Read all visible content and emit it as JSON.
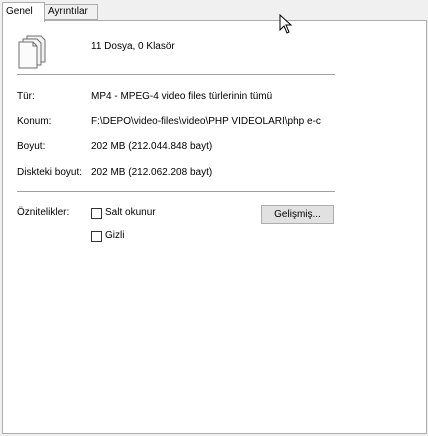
{
  "tabs": [
    {
      "label": "Genel"
    },
    {
      "label": "Ayrıntılar"
    }
  ],
  "summary": {
    "text": "11 Dosya, 0 Klasör",
    "icon": "documents-icon"
  },
  "fields": {
    "type": {
      "label": "Tür:",
      "value": "MP4 - MPEG-4 video files türlerinin tümü"
    },
    "location": {
      "label": "Konum:",
      "value": "F:\\DEPO\\video-files\\video\\PHP VİDEOLARI\\php e-c"
    },
    "size": {
      "label": "Boyut:",
      "value": "202 MB (212.044.848 bayt)"
    },
    "disk_size": {
      "label": "Diskteki boyut:",
      "value": "202 MB (212.062.208 bayt)"
    }
  },
  "attributes": {
    "label": "Öznitelikler:",
    "readonly": {
      "label": "Salt okunur",
      "checked": false
    },
    "hidden": {
      "label": "Gizli",
      "checked": false
    },
    "advanced_button": "Gelişmiş..."
  }
}
